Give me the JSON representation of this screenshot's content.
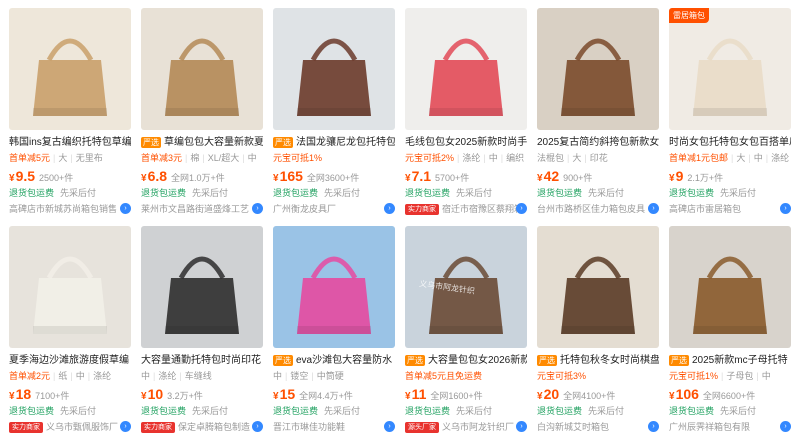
{
  "products": [
    {
      "title": "韩国ins复古编织托特包草编",
      "badge": "",
      "meta": [
        "首单减5元",
        "大",
        "无里布"
      ],
      "price": "9.5",
      "sold": "2500+件",
      "svc": [
        "退货包运费",
        "先采后付"
      ],
      "shop_tag": "",
      "shop": "高碑店市新城苏尚箱包销售",
      "ribbon": "",
      "watermark": ""
    },
    {
      "title": "草编包包大容量新款夏",
      "badge": "严选",
      "meta": [
        "首单减3元",
        "棉",
        "XL/超大",
        "中"
      ],
      "price": "6.8",
      "sold": "全网1.0万+件",
      "svc": [
        "退货包运费",
        "先采后付"
      ],
      "shop_tag": "",
      "shop": "莱州市文昌路街道盛烽工艺",
      "ribbon": "",
      "watermark": ""
    },
    {
      "title": "法国龙骧尼龙包托特包",
      "badge": "严选",
      "meta": [
        "元宝可抵1%"
      ],
      "price": "165",
      "sold": "全网3600+件",
      "svc": [
        "退货包运费",
        "先采后付"
      ],
      "shop_tag": "",
      "shop": "广州衡龙皮具厂",
      "ribbon": "",
      "watermark": ""
    },
    {
      "title": "毛线包包女2025新款时尚手",
      "badge": "",
      "meta": [
        "元宝可抵2%",
        "涤纶",
        "中",
        "编织"
      ],
      "price": "7.1",
      "sold": "5700+件",
      "svc": [
        "退货包运费",
        "先采后付"
      ],
      "shop_tag": "实力商家",
      "shop": "宿迁市宿豫区蔡翔箱",
      "ribbon": "",
      "watermark": ""
    },
    {
      "title": "2025复古简约斜挎包新款女",
      "badge": "",
      "meta": [
        "法棍包",
        "大",
        "印花"
      ],
      "price": "42",
      "sold": "900+件",
      "svc": [
        "退货包运费",
        "先采后付"
      ],
      "shop_tag": "",
      "shop": "台州市路桥区佳力箱包皮具",
      "ribbon": "",
      "watermark": ""
    },
    {
      "title": "时尚女包托特包女包百搭单肩",
      "badge": "",
      "meta": [
        "首单减1元包邮",
        "大",
        "中",
        "涤纶"
      ],
      "price": "9",
      "sold": "2.1万+件",
      "svc": [
        "退货包运费",
        "先采后付"
      ],
      "shop_tag": "",
      "shop": "高碑店市雷居箱包",
      "ribbon": "雷居箱包",
      "watermark": ""
    },
    {
      "title": "夏季海边沙滩旅游度假草编",
      "badge": "",
      "meta": [
        "首单减2元",
        "纸",
        "中",
        "涤纶"
      ],
      "price": "18",
      "sold": "7100+件",
      "svc": [
        "退货包运费",
        "先采后付"
      ],
      "shop_tag": "实力商家",
      "shop": "义乌市甄佩服饰厂",
      "ribbon": "",
      "watermark": ""
    },
    {
      "title": "大容量通勤托特包时尚印花",
      "badge": "",
      "meta": [
        "中",
        "涤纶",
        "车缝线"
      ],
      "price": "10",
      "sold": "3.2万+件",
      "svc": [
        "退货包运费",
        "先采后付"
      ],
      "shop_tag": "实力商家",
      "shop": "保定卓腾箱包制造",
      "ribbon": "",
      "watermark": ""
    },
    {
      "title": "eva沙滩包大容量防水",
      "badge": "严选",
      "meta": [
        "中",
        "镂空",
        "中筒硬"
      ],
      "price": "15",
      "sold": "全网4.4万+件",
      "svc": [
        "退货包运费",
        "先采后付"
      ],
      "shop_tag": "",
      "shop": "晋江市琳佳功能鞋",
      "ribbon": "",
      "watermark": ""
    },
    {
      "title": "大容量包包女2026新款",
      "badge": "严选",
      "meta": [
        "首单减5元且免运费"
      ],
      "price": "11",
      "sold": "全网1600+件",
      "svc": [
        "退货包运费",
        "先采后付"
      ],
      "shop_tag": "源头厂家",
      "shop": "义乌市阿龙针织厂",
      "ribbon": "",
      "watermark": "义乌市阿龙针织"
    },
    {
      "title": "托特包秋冬女时尚棋盘",
      "badge": "严选",
      "meta": [
        "元宝可抵3%"
      ],
      "price": "20",
      "sold": "全网4100+件",
      "svc": [
        "退货包运费",
        "先采后付"
      ],
      "shop_tag": "",
      "shop": "白沟新城艾时箱包",
      "ribbon": "",
      "watermark": ""
    },
    {
      "title": "2025新款mc子母托特",
      "badge": "严选",
      "meta": [
        "元宝可抵1%",
        "子母包",
        "中"
      ],
      "price": "106",
      "sold": "全网6600+件",
      "svc": [
        "退货包运费",
        "先采后付"
      ],
      "shop_tag": "",
      "shop": "广州辰霁祥箱包有限",
      "ribbon": "",
      "watermark": ""
    }
  ],
  "currency": "¥",
  "colors": {
    "price": "#ff5000",
    "service": "#20a160",
    "muted": "#999999",
    "badge": "#ff8a00",
    "tag": "#e8332e"
  }
}
